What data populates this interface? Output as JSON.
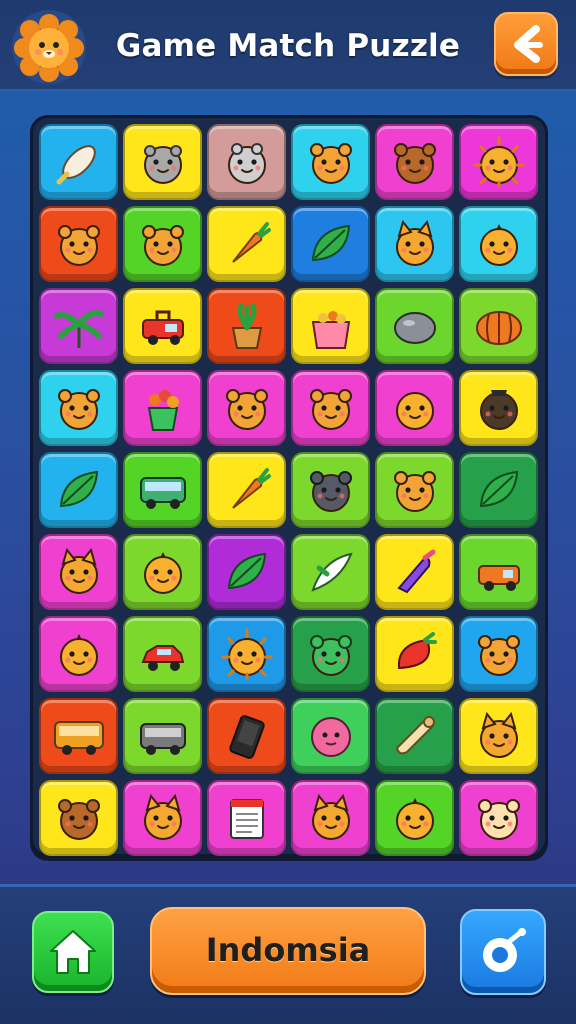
{
  "header": {
    "title": "Game Match Puzzle",
    "logo_icon": "lion-face-icon",
    "back_icon": "back-arrow-icon"
  },
  "footer": {
    "home_icon": "home-icon",
    "main_button_label": "Indomsia",
    "hint_icon": "hint-bomb-icon"
  },
  "colors": {
    "cyan": "#27c8f0",
    "yellow": "#ffe61a",
    "pink": "#d29a9a",
    "magenta": "#f03cd8",
    "orange_red": "#ef4a1a",
    "green": "#58d628",
    "blue": "#1f7fe0",
    "purple": "#b02cd8",
    "dark_green": "#26a04a",
    "header_bg": "#1e3a6e",
    "accent_orange": "#f07814"
  },
  "board": {
    "rows": [
      [
        {
          "color": "#22b3ef",
          "icon": "wrapped-candy"
        },
        {
          "color": "#ffe61a",
          "icon": "gray-hamster"
        },
        {
          "color": "#d39c9a",
          "icon": "gray-ghost"
        },
        {
          "color": "#2fd2ee",
          "icon": "bear-face"
        },
        {
          "color": "#f040d0",
          "icon": "brown-bear"
        },
        {
          "color": "#ee37d8",
          "icon": "sun-face"
        }
      ],
      [
        {
          "color": "#ef4a1a",
          "icon": "bear-face"
        },
        {
          "color": "#55d428",
          "icon": "bear-face"
        },
        {
          "color": "#ffe61a",
          "icon": "carrot"
        },
        {
          "color": "#1f7fe0",
          "icon": "leaf"
        },
        {
          "color": "#2cc6f0",
          "icon": "fox-face"
        },
        {
          "color": "#2fd2ee",
          "icon": "lemon-face"
        }
      ],
      [
        {
          "color": "#c83ad8",
          "icon": "palm-plant"
        },
        {
          "color": "#ffe61a",
          "icon": "red-truck"
        },
        {
          "color": "#ef4a1a",
          "icon": "potted-plant"
        },
        {
          "color": "#ffe61a",
          "icon": "fruit-basket"
        },
        {
          "color": "#6ad62e",
          "icon": "stone"
        },
        {
          "color": "#7dd82e",
          "icon": "pumpkin"
        }
      ],
      [
        {
          "color": "#2fd2ee",
          "icon": "bear-face"
        },
        {
          "color": "#f040d0",
          "icon": "flower-pot"
        },
        {
          "color": "#f040d0",
          "icon": "bear-face"
        },
        {
          "color": "#f040d0",
          "icon": "bear-face"
        },
        {
          "color": "#f040d0",
          "icon": "smiley-face"
        },
        {
          "color": "#ffe61a",
          "icon": "mole-face"
        }
      ],
      [
        {
          "color": "#22b3ef",
          "icon": "leaf"
        },
        {
          "color": "#55d428",
          "icon": "bus"
        },
        {
          "color": "#ffe61a",
          "icon": "carrot"
        },
        {
          "color": "#7dd82e",
          "icon": "dark-bear"
        },
        {
          "color": "#7dd82e",
          "icon": "bear-face"
        },
        {
          "color": "#26a04a",
          "icon": "leaf"
        }
      ],
      [
        {
          "color": "#f040d0",
          "icon": "fox-face"
        },
        {
          "color": "#7dd82e",
          "icon": "lemon-face"
        },
        {
          "color": "#b02cd8",
          "icon": "leaf"
        },
        {
          "color": "#7dd82e",
          "icon": "feather"
        },
        {
          "color": "#ffe61a",
          "icon": "purple-candy"
        },
        {
          "color": "#6ad62e",
          "icon": "orange-truck"
        }
      ],
      [
        {
          "color": "#f040d0",
          "icon": "lemon-face"
        },
        {
          "color": "#7dd82e",
          "icon": "red-car"
        },
        {
          "color": "#1f9ae8",
          "icon": "sun-face"
        },
        {
          "color": "#26a04a",
          "icon": "green-bear"
        },
        {
          "color": "#ffe61a",
          "icon": "strawberry"
        },
        {
          "color": "#1fa6ee",
          "icon": "bear-face"
        }
      ],
      [
        {
          "color": "#ef4a1a",
          "icon": "orange-bus"
        },
        {
          "color": "#7dd82e",
          "icon": "gray-bus"
        },
        {
          "color": "#ef4a1a",
          "icon": "phone"
        },
        {
          "color": "#3ed05a",
          "icon": "pink-ball"
        },
        {
          "color": "#26a04a",
          "icon": "scroll"
        },
        {
          "color": "#ffe61a",
          "icon": "fox-face"
        }
      ],
      [
        {
          "color": "#ffe61a",
          "icon": "brown-bear"
        },
        {
          "color": "#f040d0",
          "icon": "fox-face"
        },
        {
          "color": "#f040d0",
          "icon": "notepad"
        },
        {
          "color": "#f040d0",
          "icon": "fox-face"
        },
        {
          "color": "#55d428",
          "icon": "lemon-face"
        },
        {
          "color": "#f040d0",
          "icon": "cream-bear"
        }
      ]
    ]
  }
}
